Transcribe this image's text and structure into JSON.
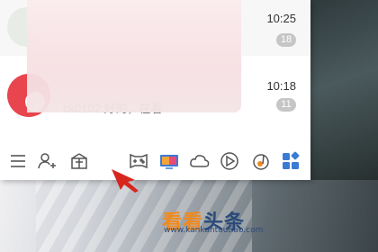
{
  "chats": [
    {
      "time": "10:25",
      "unread": "18",
      "preview": ""
    },
    {
      "time": "10:18",
      "unread": "11",
      "preview": "ck0102:好的，在看"
    }
  ],
  "toolbar": {
    "icons": [
      "menu-icon",
      "add-contact-icon",
      "gift-icon",
      "game-icon",
      "live-tv-icon",
      "cloud-icon",
      "play-icon",
      "music-icon",
      "apps-grid-icon"
    ]
  },
  "watermark": {
    "part1": "看看",
    "part2": "头条",
    "url": "www.kankantoutiao.com"
  },
  "colors": {
    "accent_red": "#e8454f",
    "badge_gray": "#c6c6c6",
    "app_orange": "#f08a1e",
    "app_blue": "#3a7bd5"
  }
}
